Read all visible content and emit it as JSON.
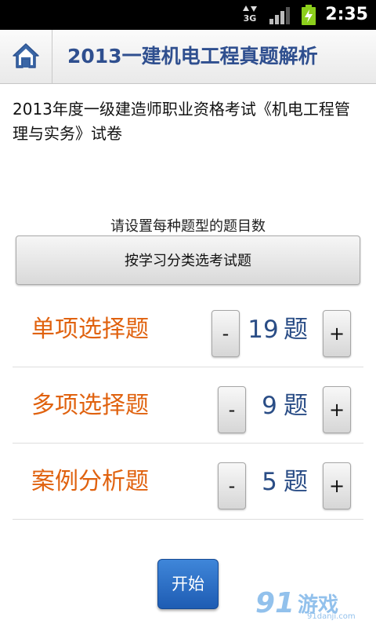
{
  "status_bar": {
    "network": "3G",
    "time": "2:35"
  },
  "header": {
    "title": "2013一建机电工程真题解析",
    "home_icon": "home-icon"
  },
  "paper": {
    "title": "2013年度一级建造师职业资格考试《机电工程管理与实务》试卷"
  },
  "setup": {
    "label": "请设置每种题型的题目数",
    "classify_button": "按学习分类选考试题"
  },
  "questions": [
    {
      "type": "单项选择题",
      "count": "19",
      "unit": "题",
      "minus": "-",
      "plus": "+"
    },
    {
      "type": "多项选择题",
      "count": "9",
      "unit": "题",
      "minus": "-",
      "plus": "+"
    },
    {
      "type": "案例分析题",
      "count": "5",
      "unit": "题",
      "minus": "-",
      "plus": "+"
    }
  ],
  "start_button": "开始",
  "watermark": {
    "logo": "91",
    "name": "游戏",
    "url": "91danji.com"
  },
  "colors": {
    "title": "#2f4f8f",
    "question_label": "#e0620f",
    "count": "#2a4d86",
    "start_button": "#2a6ec6"
  }
}
